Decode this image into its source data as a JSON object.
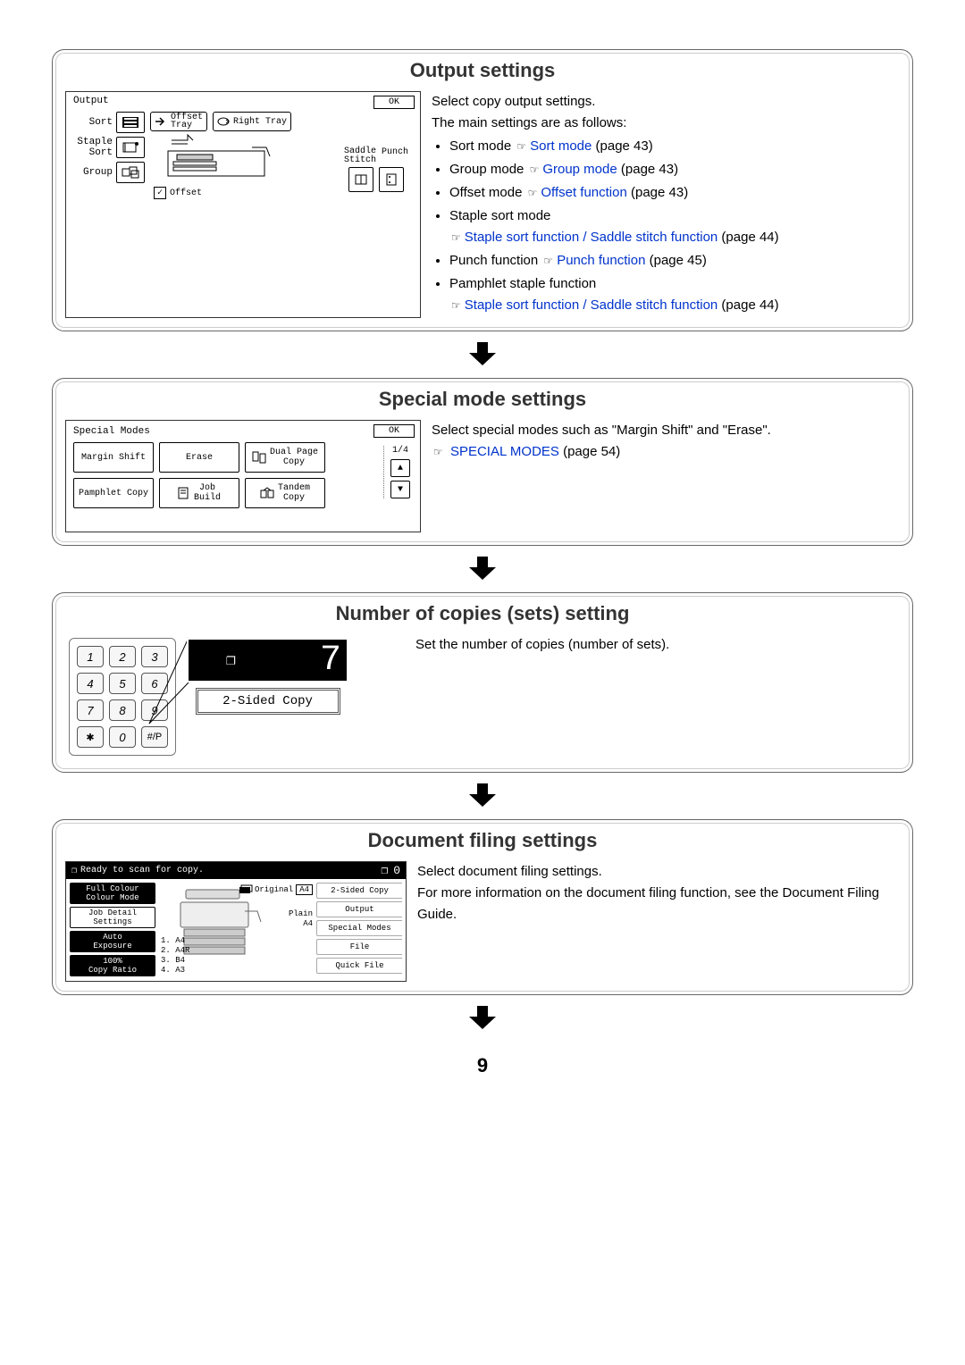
{
  "page_number": "9",
  "sections": {
    "output": {
      "title": "Output settings",
      "desc_intro1": "Select copy output settings.",
      "desc_intro2": "The main settings are as follows:",
      "items": {
        "sort": {
          "label": "Sort mode",
          "link": "Sort mode",
          "page": " (page 43)"
        },
        "group": {
          "label": "Group mode",
          "link": "Group mode",
          "page": " (page 43)"
        },
        "offset": {
          "label": "Offset mode",
          "link": "Offset function",
          "page": " (page 43)"
        },
        "staple": {
          "label": "Staple sort mode",
          "link": "Staple sort function / Saddle stitch function",
          "page": " (page 44)"
        },
        "punch": {
          "label": "Punch function",
          "link": "Punch function",
          "page": " (page 45)"
        },
        "pamphlet": {
          "label": "Pamphlet staple function",
          "link": "Staple sort function / Saddle stitch function",
          "page": " (page 44)"
        }
      },
      "ill": {
        "header": "Output",
        "ok": "OK",
        "left": {
          "sort": "Sort",
          "staple_sort": "Staple\nSort",
          "group": "Group"
        },
        "offset_tray": "Offset\nTray",
        "right_tray": "Right Tray",
        "offset_chk": "Offset",
        "saddle_stitch": "Saddle\nStitch",
        "punch": "Punch"
      }
    },
    "special": {
      "title": "Special mode settings",
      "desc": "Select special modes such as \"Margin Shift\" and \"Erase\".",
      "link": "SPECIAL MODES",
      "page": " (page 54)",
      "ill": {
        "header": "Special Modes",
        "ok": "OK",
        "page_count": "1/4",
        "btns": {
          "margin_shift": "Margin Shift",
          "erase": "Erase",
          "dual_page": "Dual Page\nCopy",
          "pamphlet_copy": "Pamphlet Copy",
          "job_build": "Job\nBuild",
          "tandem_copy": "Tandem\nCopy"
        }
      }
    },
    "copies": {
      "title": "Number of copies (sets) setting",
      "desc": "Set the number of copies (number of sets).",
      "ill": {
        "keys": [
          "1",
          "2",
          "3",
          "4",
          "5",
          "6",
          "7",
          "8",
          "9",
          "✱",
          "0",
          "#/P"
        ],
        "display": "7",
        "label": "2-Sided Copy"
      }
    },
    "filing": {
      "title": "Document filing settings",
      "desc1": "Select document filing settings.",
      "desc2": "For more information on the document filing function, see the Document Filing Guide.",
      "ill": {
        "top_text": "Ready to scan for copy.",
        "top_count": "0",
        "left": {
          "colour_mode_top": "Full Colour",
          "colour_mode_bot": "Colour Mode",
          "job_detail_top": "Job Detail",
          "job_detail_bot": "Settings",
          "exposure_top": "Auto",
          "exposure_bot": "Exposure",
          "ratio_top": "100%",
          "ratio_bot": "Copy Ratio"
        },
        "mid": {
          "original": "Original",
          "a4_top": "A4",
          "plain": "Plain",
          "a4_mid": "A4",
          "t1": "1.   A4",
          "t2": "2.  A4R",
          "t3": "3.   B4",
          "t4": "4.   A3"
        },
        "right": {
          "two_sided": "2-Sided Copy",
          "output": "Output",
          "special": "Special Modes",
          "file": "File",
          "quick_file": "Quick File"
        }
      }
    }
  }
}
